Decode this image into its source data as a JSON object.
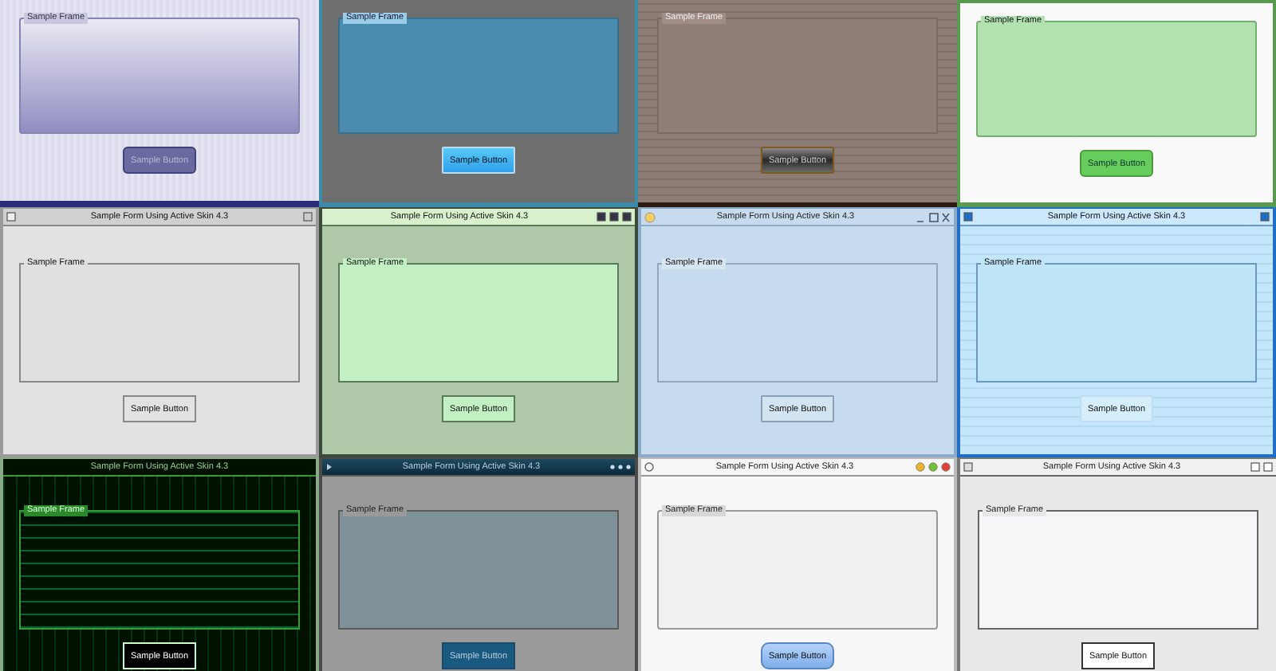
{
  "skins": [
    {
      "kind": "lavender",
      "frame_label": "Sample Frame",
      "button_label": "Sample Button"
    },
    {
      "kind": "steel",
      "frame_label": "Sample Frame",
      "button_label": "Sample Button"
    },
    {
      "kind": "bronze",
      "frame_label": "Sample Frame",
      "button_label": "Sample Button"
    },
    {
      "kind": "mint",
      "frame_label": "Sample Frame",
      "button_label": "Sample Button"
    },
    {
      "kind": "classic",
      "title": "Sample Form Using Active Skin 4.3",
      "frame_label": "Sample Frame",
      "button_label": "Sample Button"
    },
    {
      "kind": "sage",
      "title": "Sample Form Using Active Skin 4.3",
      "frame_label": "Sample Frame",
      "button_label": "Sample Button"
    },
    {
      "kind": "frost",
      "title": "Sample Form Using Active Skin 4.3",
      "frame_label": "Sample Frame",
      "button_label": "Sample Button"
    },
    {
      "kind": "gridblue",
      "title": "Sample Form Using Active Skin 4.3",
      "frame_label": "Sample Frame",
      "button_label": "Sample Button"
    },
    {
      "kind": "matrix",
      "title": "Sample Form Using Active Skin 4.3",
      "frame_label": "Sample Frame",
      "button_label": "Sample Button"
    },
    {
      "kind": "slate",
      "title": "Sample Form Using Active Skin 4.3",
      "frame_label": "Sample Frame",
      "button_label": "Sample Button"
    },
    {
      "kind": "paper",
      "title": "Sample Form Using Active Skin 4.3",
      "frame_label": "Sample Frame",
      "button_label": "Sample Button"
    },
    {
      "kind": "mono",
      "title": "Sample Form Using Active Skin 4.3",
      "frame_label": "Sample Frame",
      "button_label": "Sample Button"
    }
  ]
}
